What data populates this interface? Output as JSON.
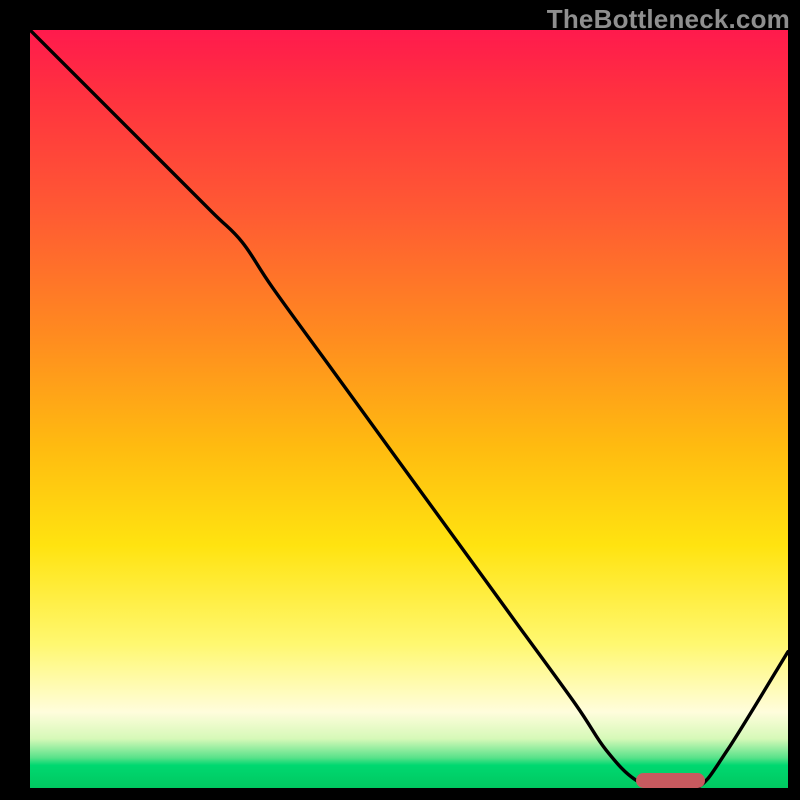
{
  "watermark": "TheBottleneck.com",
  "chart_data": {
    "type": "line",
    "title": "",
    "xlabel": "",
    "ylabel": "",
    "xlim": [
      0,
      100
    ],
    "ylim": [
      0,
      100
    ],
    "x": [
      0,
      8,
      16,
      24,
      28,
      32,
      40,
      48,
      56,
      64,
      72,
      76,
      80,
      84,
      88,
      92,
      100
    ],
    "values": [
      100,
      92,
      84,
      76,
      72,
      66,
      55,
      44,
      33,
      22,
      11,
      5,
      1,
      0,
      0,
      5,
      18
    ],
    "highlight_zone": {
      "x_start": 80,
      "x_end": 89,
      "color": "#c75a5f"
    }
  },
  "colors": {
    "gradient_top": "#ff1a4d",
    "gradient_mid": "#ffe310",
    "gradient_bottom": "#00c860",
    "curve": "#000000",
    "frame": "#000000",
    "watermark": "#8f8f8f",
    "highlight": "#c75a5f"
  }
}
